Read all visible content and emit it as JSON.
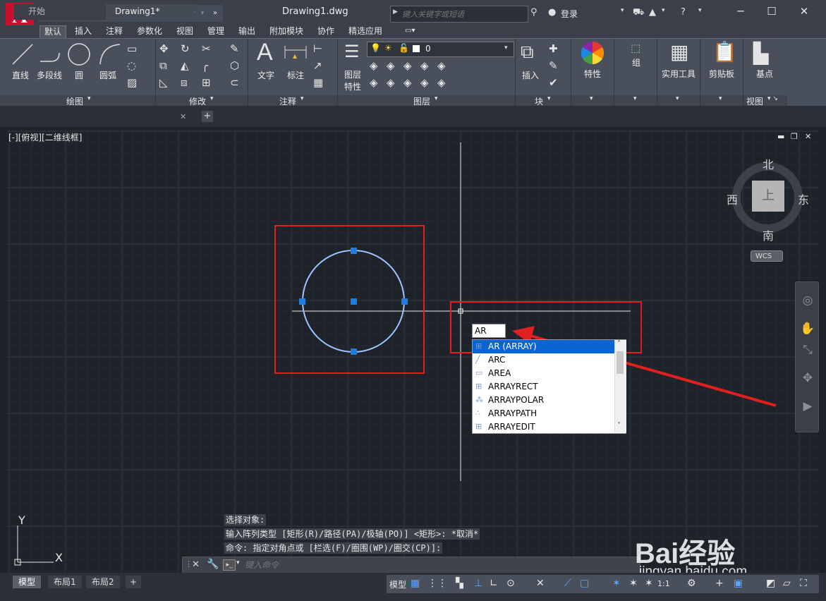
{
  "app": {
    "logo_letter": "A",
    "document_title": "Drawing1.dwg",
    "search_placeholder": "键入关键字或短语",
    "login_label": "登录"
  },
  "ribbon_tabs": [
    "默认",
    "插入",
    "注释",
    "参数化",
    "视图",
    "管理",
    "输出",
    "附加模块",
    "协作",
    "精选应用"
  ],
  "ribbon": {
    "draw_tools": {
      "line": "直线",
      "polyline": "多段线",
      "circle": "圆",
      "arc": "圆弧"
    },
    "text_tool": "文字",
    "dimension_tool": "标注",
    "layer_properties": [
      "图层",
      "特性"
    ],
    "layer_current": "0",
    "insert_tool": "插入",
    "properties_tool": "特性",
    "group_tool": "组",
    "utilities_tool": "实用工具",
    "clipboard_tool": "剪贴板",
    "basepoint_tool": "基点",
    "panels": {
      "draw": "绘图",
      "modify": "修改",
      "annotation": "注释",
      "layers": "图层",
      "block": "块",
      "view": "视图"
    }
  },
  "doc_tabs": {
    "start": "开始",
    "drawing": "Drawing1*"
  },
  "viewport": {
    "label": "[-][俯视][二维线框]",
    "compass": {
      "north": "北",
      "south": "南",
      "east": "东",
      "west": "西",
      "top": "上"
    },
    "wcs": "WCS"
  },
  "ucs": {
    "x": "X",
    "y": "Y"
  },
  "autocomplete": {
    "typed": "AR",
    "items": [
      "AR (ARRAY)",
      "ARC",
      "AREA",
      "ARRAYRECT",
      "ARRAYPOLAR",
      "ARRAYPATH",
      "ARRAYEDIT"
    ],
    "selected_index": 0
  },
  "command_history": [
    "选择对象:",
    "输入阵列类型 [矩形(R)/路径(PA)/极轴(PO)] <矩形>: *取消*",
    "命令: 指定对角点或 [栏选(F)/圈围(WP)/圈交(CP)]:"
  ],
  "command_prompt_placeholder": "键入命令",
  "layout_tabs": [
    "模型",
    "布局1",
    "布局2"
  ],
  "status": {
    "model_label": "模型",
    "scale": "1:1"
  },
  "watermark": {
    "text": "Bai经验",
    "url": "jingyan.baidu.com"
  },
  "colors": {
    "accent_red": "#e0201e",
    "selection_blue": "#0a64d2",
    "grip_blue": "#1e7ee0",
    "canvas_bg": "#1e2229"
  }
}
